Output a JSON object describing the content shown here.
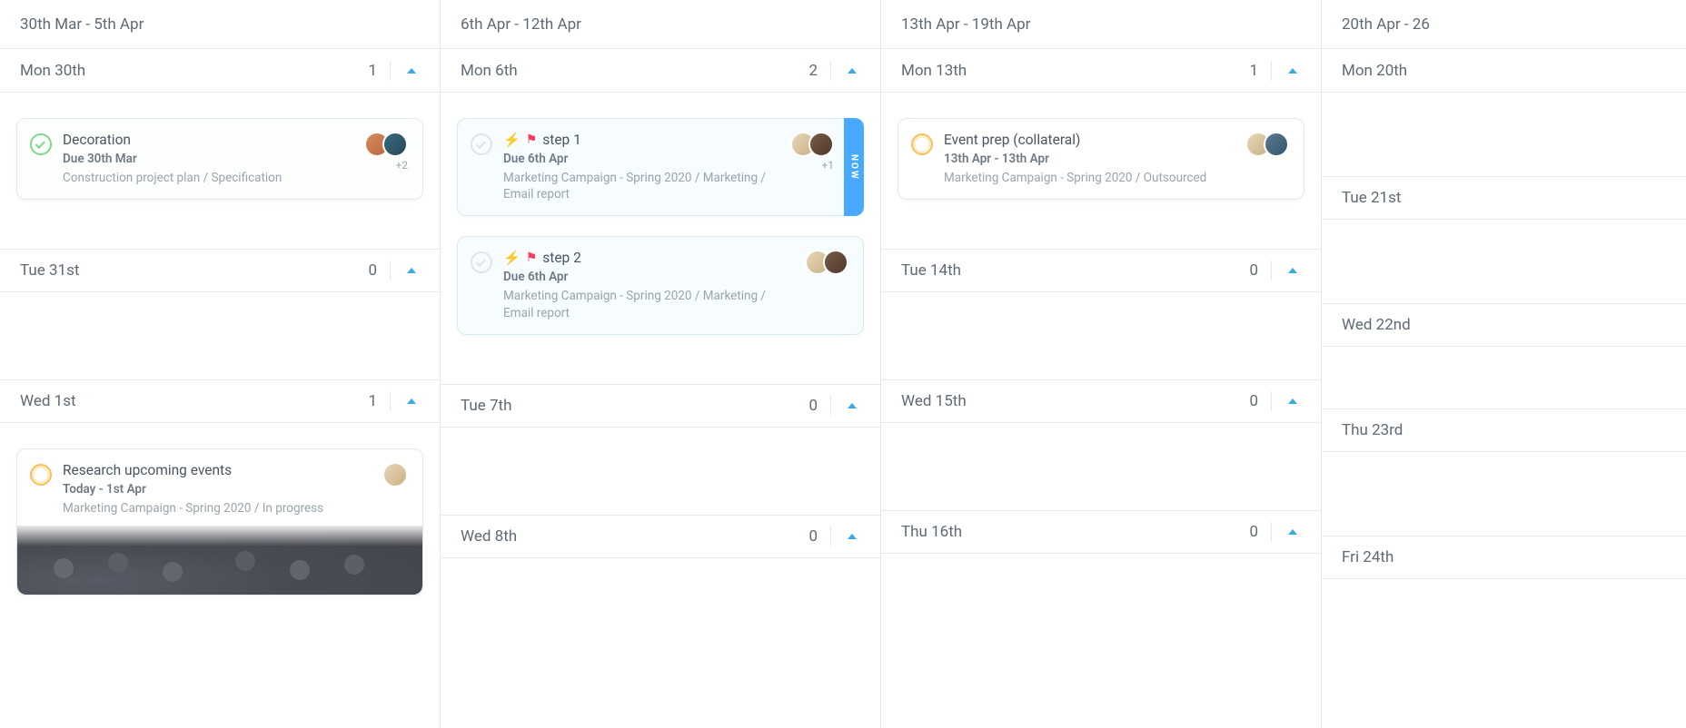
{
  "weeks": [
    {
      "range": "30th Mar - 5th Apr",
      "days": [
        {
          "label": "Mon 30th",
          "count": "1",
          "cards": [
            {
              "check": "green",
              "title": "Decoration",
              "due": "Due 30th Mar",
              "path": "Construction project plan / Specification",
              "avatars": [
                "a1",
                "a2"
              ],
              "more": "+2",
              "tint": "green"
            }
          ]
        },
        {
          "label": "Tue 31st",
          "count": "0",
          "cards": []
        },
        {
          "label": "Wed 1st",
          "count": "1",
          "cards": [
            {
              "check": "amber",
              "title": "Research upcoming events",
              "due": "Today - 1st Apr",
              "path": "Marketing Campaign - Spring 2020 / In progress",
              "avatars": [
                "a3"
              ],
              "image": true
            }
          ]
        }
      ]
    },
    {
      "range": "6th Apr - 12th Apr",
      "days": [
        {
          "label": "Mon 6th",
          "count": "2",
          "cards": [
            {
              "check": "grey",
              "bolt": true,
              "flag": true,
              "title": "step 1",
              "due": "Due 6th Apr",
              "path": "Marketing Campaign - Spring 2020 / Marketing / Email report",
              "avatars": [
                "a3",
                "a4"
              ],
              "more": "+1",
              "now": true,
              "tint": "blue"
            },
            {
              "check": "grey",
              "bolt": true,
              "flag": true,
              "title": "step 2",
              "due": "Due 6th Apr",
              "path": "Marketing Campaign - Spring 2020 / Marketing / Email report",
              "avatars": [
                "a3",
                "a4"
              ],
              "tint": "blue"
            }
          ]
        },
        {
          "label": "Tue 7th",
          "count": "0",
          "cards": []
        },
        {
          "label": "Wed 8th",
          "count": "0",
          "cards": []
        }
      ]
    },
    {
      "range": "13th Apr - 19th Apr",
      "days": [
        {
          "label": "Mon 13th",
          "count": "1",
          "cards": [
            {
              "check": "amber",
              "title": "Event prep (collateral)",
              "due": "13th Apr - 13th Apr",
              "path": "Marketing Campaign - Spring 2020 / Outsourced",
              "avatars": [
                "a3",
                "a6"
              ]
            }
          ]
        },
        {
          "label": "Tue 14th",
          "count": "0",
          "cards": []
        },
        {
          "label": "Wed 15th",
          "count": "0",
          "cards": []
        },
        {
          "label": "Thu 16th",
          "count": "0",
          "cards": []
        }
      ]
    },
    {
      "range": "20th Apr - 26",
      "compact": true,
      "days": [
        {
          "label": "Mon 20th"
        },
        {
          "label": "Tue 21st"
        },
        {
          "label": "Wed 22nd"
        },
        {
          "label": "Thu 23rd"
        },
        {
          "label": "Fri 24th"
        }
      ]
    }
  ],
  "now_label": "NOW"
}
